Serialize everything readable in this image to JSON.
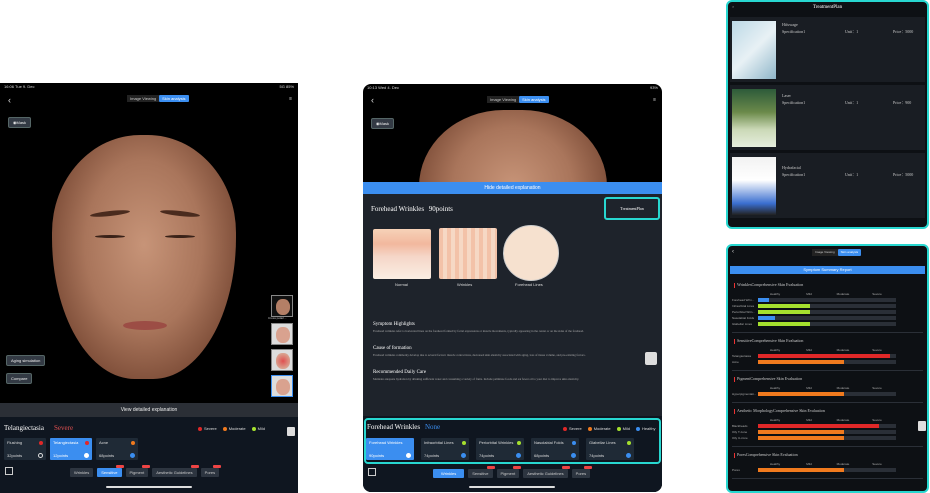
{
  "panel1": {
    "status_left": "16:06  Tue 9. Dec",
    "status_right": "5G 85%",
    "view_toggle": [
      "Image Viewing",
      "Skin analysis"
    ],
    "mask_label": "Mask",
    "thumb_label": "Cross polari...",
    "aging_label": "Aging simulation",
    "compare_label": "Compare",
    "view_explanation": "View detailed explanation",
    "condition_title": "Telangiectasia",
    "condition_severity": "Severe",
    "legend": [
      "Severe",
      "Moderate",
      "Mild",
      "Healthy"
    ],
    "cards": [
      {
        "name": "Flushing",
        "points": "32points"
      },
      {
        "name": "Telangiectasia",
        "points": "12points"
      },
      {
        "name": "Acne",
        "points": "68points"
      }
    ],
    "tabs": [
      "Wrinkles",
      "Sensitive",
      "Pigment",
      "Aesthetic Guidelines",
      "Pores"
    ]
  },
  "panel2": {
    "status_left": "10:13  Wed 4. Dec",
    "status_right": "93%",
    "view_toggle": [
      "Image Viewing",
      "Skin analysis"
    ],
    "mask_label": "Mask",
    "hide_explanation": "Hide detailed explanation",
    "section_title": "Forehead Wrinkles",
    "section_points": "90points",
    "treatment_plan": "TreatmentPlan",
    "illustrations": [
      "Normal",
      "Wrinkles",
      "Forehead Lines"
    ],
    "symptom_title": "Symptom Highlights",
    "symptom_text": "Forehead wrinkles refer to horizontal lines on the forehead formed by facial expressions or muscle movements, typically appearing in the center or on the sides of the forehead.",
    "cause_title": "Cause of formation",
    "cause_text": "Forehead wrinkles commonly develop due to several factors: muscle contractions, decreased skin elasticity associated with aging, loss of tissue volume, and pre-existing factors.",
    "care_title": "Recommended Daily Care",
    "care_text": "Maintain adequate hydration by drinking sufficient water and consuming a variety of fruits. Include palmitate foods and eat fewer oil to your diet to improve skin elasticity.",
    "condition_title": "Forehead Wrinkles",
    "condition_severity": "None",
    "legend": [
      "Severe",
      "Moderate",
      "Mild",
      "Healthy"
    ],
    "cards": [
      {
        "name": "Forehead Wrinkles",
        "points": "90points"
      },
      {
        "name": "Infraorbital Lines",
        "points": "74points"
      },
      {
        "name": "Periorbital Wrinkles",
        "points": "74points"
      },
      {
        "name": "Nasolabial Folds",
        "points": "68points"
      },
      {
        "name": "Glabellar Lines",
        "points": "74points"
      }
    ],
    "tabs": [
      "Wrinkles",
      "Sensitive",
      "Pigment",
      "Aesthetic Guidelines",
      "Pores"
    ]
  },
  "panel3": {
    "title": "TreatmentPlan",
    "items": [
      {
        "name": "Hifuwage",
        "spec": "Specification1",
        "unit": "Unit：1",
        "price": "Price：5000"
      },
      {
        "name": "Laser",
        "spec": "Specification1",
        "unit": "Unit：1",
        "price": "Price：900"
      },
      {
        "name": "Hydrafacial",
        "spec": "Specification1",
        "unit": "Unit：1",
        "price": "Price：5000"
      }
    ]
  },
  "panel4": {
    "view_toggle": [
      "Image Viewing",
      "Skin analysis"
    ],
    "banner": "Symptom Summary Report",
    "columns": [
      "Healthy",
      "Mild",
      "Moderate",
      "Severe"
    ],
    "sections": [
      {
        "title": "WrinklesComprehensive Skin Evaluation",
        "rows": [
          {
            "label": "Forehead Wrin...",
            "level": 0.08,
            "color": "#3b8ef0"
          },
          {
            "label": "Infraorbital Lines",
            "level": 0.38,
            "color": "#a5e02e"
          },
          {
            "label": "Periorbital Wrin...",
            "level": 0.38,
            "color": "#a5e02e"
          },
          {
            "label": "Nasolabial Folds",
            "level": 0.12,
            "color": "#3b8ef0"
          },
          {
            "label": "Glabellar Lines",
            "level": 0.38,
            "color": "#a5e02e"
          }
        ]
      },
      {
        "title": "SensitiveComprehensive Skin Evaluation",
        "rows": [
          {
            "label": "Telangiectasia",
            "level": 0.96,
            "color": "#e02828"
          },
          {
            "label": "Acne",
            "level": 0.62,
            "color": "#f07a1e"
          }
        ]
      },
      {
        "title": "PigmentComprehensive Skin Evaluation",
        "rows": [
          {
            "label": "Hyperpigmentati...",
            "level": 0.62,
            "color": "#f07a1e"
          }
        ]
      },
      {
        "title": "Aesthetic MorphologyComprehensive Skin Evaluation",
        "rows": [
          {
            "label": "Blackheads",
            "level": 0.88,
            "color": "#e02828"
          },
          {
            "label": "Oily T-zone",
            "level": 0.62,
            "color": "#f07a1e"
          },
          {
            "label": "Oily U-zone",
            "level": 0.62,
            "color": "#f07a1e"
          }
        ]
      },
      {
        "title": "PoresComprehensive Skin Evaluation",
        "rows": [
          {
            "label": "Pores",
            "level": 0.62,
            "color": "#f07a1e"
          }
        ]
      }
    ]
  },
  "colors": {
    "accent": "#3b8ef0",
    "frame": "#28d7d0",
    "severe": "#e02828",
    "moderate": "#f07a1e",
    "mild": "#a5e02e",
    "healthy": "#3b8ef0"
  }
}
